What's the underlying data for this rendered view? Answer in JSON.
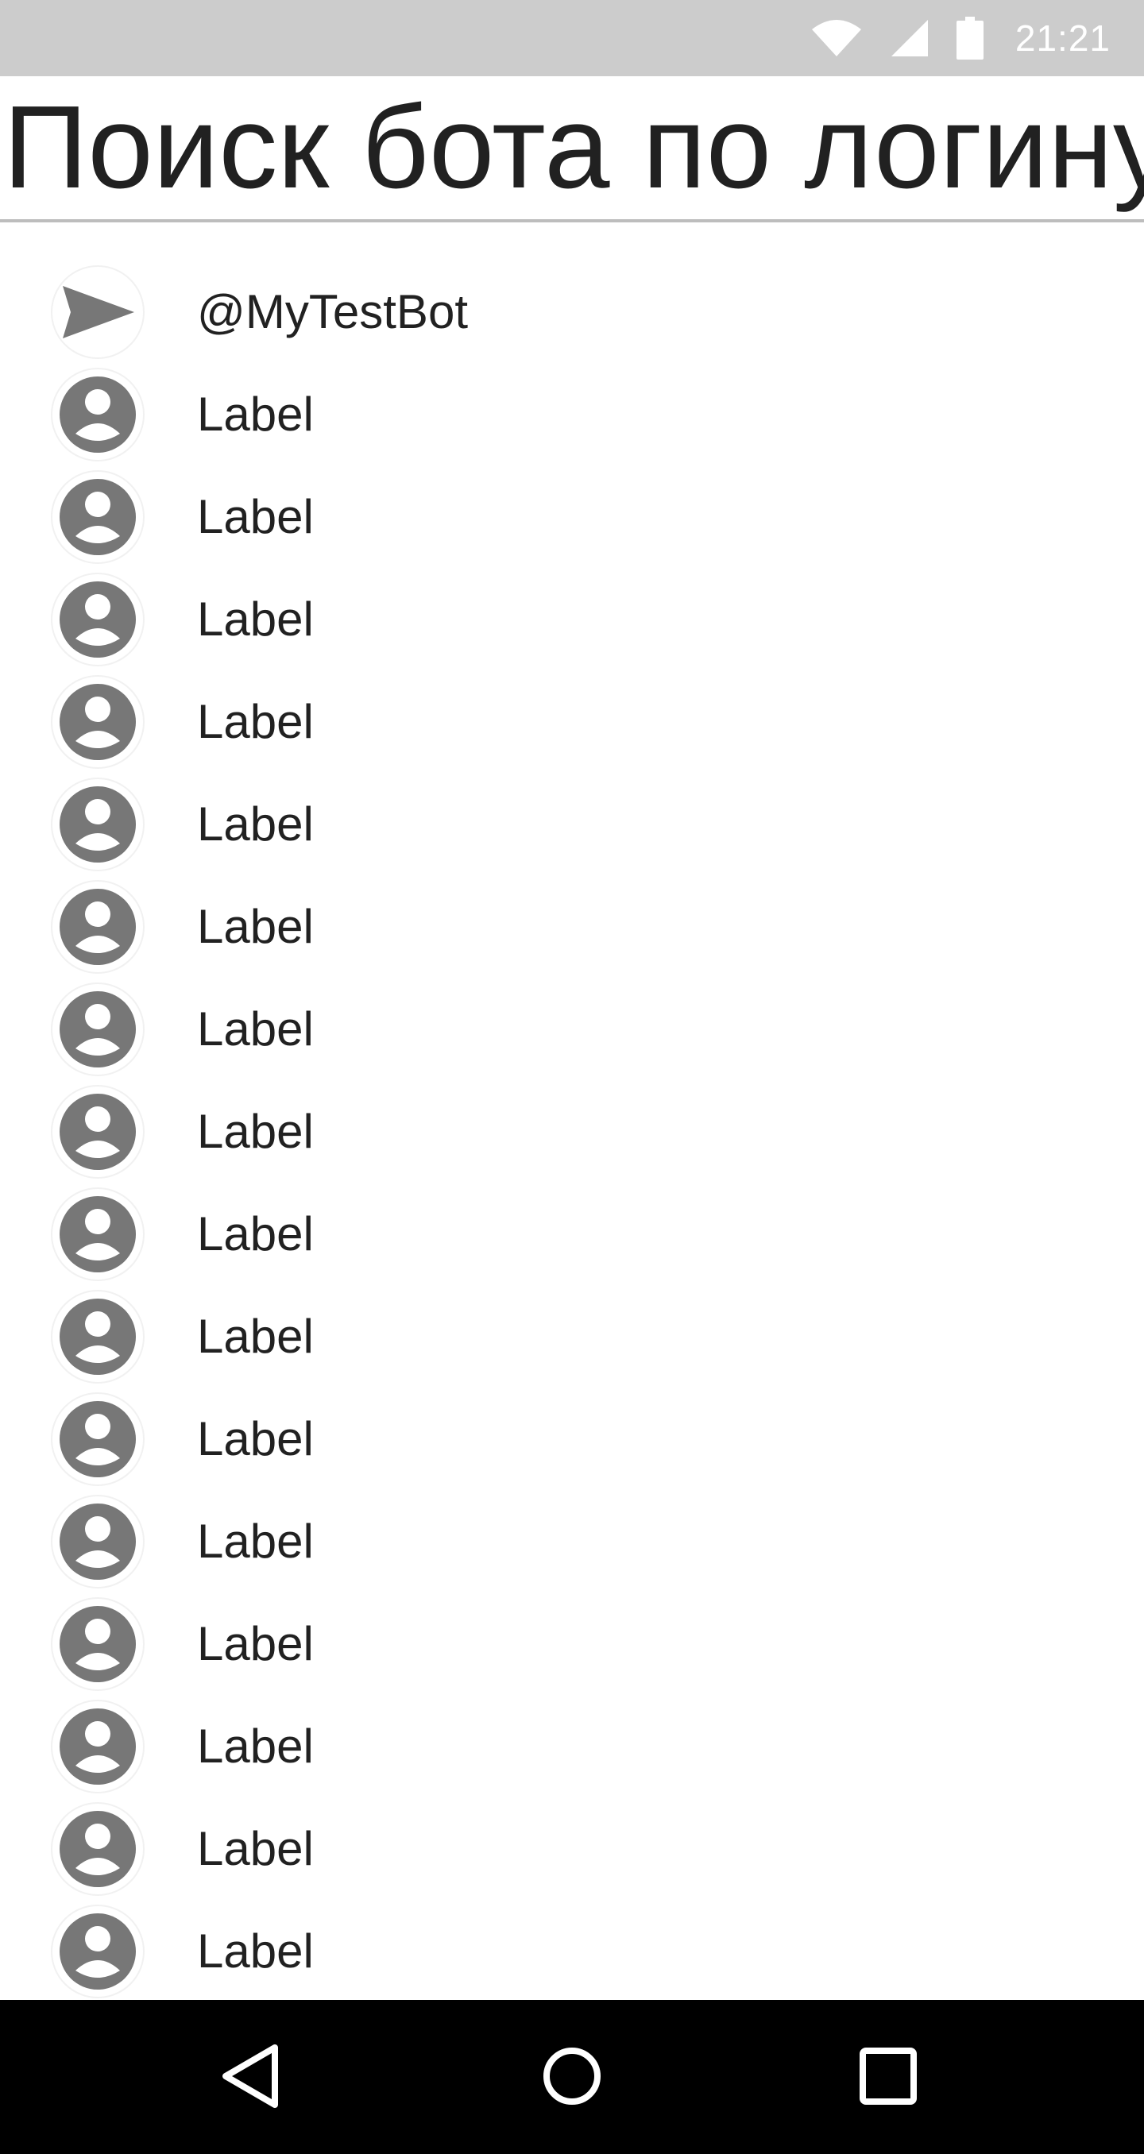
{
  "status_bar": {
    "time": "21:21",
    "icons": [
      "wifi-icon",
      "cellular-signal-icon",
      "battery-icon"
    ],
    "background": "#cccccc"
  },
  "search": {
    "value": "Поиск бота по логину",
    "underline_color": "#bdbdbd"
  },
  "results": [
    {
      "label": "@MyTestBot",
      "icon": "send-icon"
    },
    {
      "label": "Label",
      "icon": "account-icon"
    },
    {
      "label": "Label",
      "icon": "account-icon"
    },
    {
      "label": "Label",
      "icon": "account-icon"
    },
    {
      "label": "Label",
      "icon": "account-icon"
    },
    {
      "label": "Label",
      "icon": "account-icon"
    },
    {
      "label": "Label",
      "icon": "account-icon"
    },
    {
      "label": "Label",
      "icon": "account-icon"
    },
    {
      "label": "Label",
      "icon": "account-icon"
    },
    {
      "label": "Label",
      "icon": "account-icon"
    },
    {
      "label": "Label",
      "icon": "account-icon"
    },
    {
      "label": "Label",
      "icon": "account-icon"
    },
    {
      "label": "Label",
      "icon": "account-icon"
    },
    {
      "label": "Label",
      "icon": "account-icon"
    },
    {
      "label": "Label",
      "icon": "account-icon"
    },
    {
      "label": "Label",
      "icon": "account-icon"
    },
    {
      "label": "Label",
      "icon": "account-icon"
    }
  ],
  "icon_color": "#777777",
  "nav_bar": {
    "buttons": [
      "back-icon",
      "home-icon",
      "recents-icon"
    ],
    "background": "#000000"
  }
}
